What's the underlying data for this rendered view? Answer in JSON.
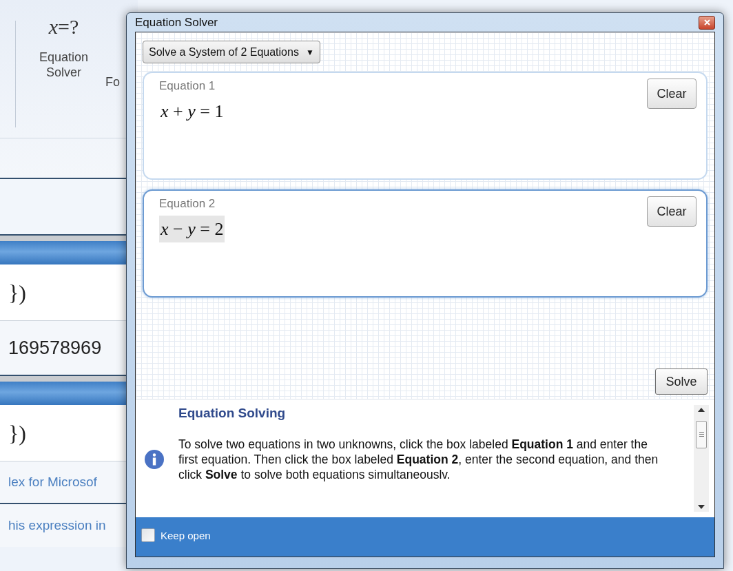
{
  "background_app": {
    "ribbon_button": {
      "icon_label": "*x*=?",
      "label": "Equation Solver"
    },
    "cut_ribbon_label": "Fo",
    "rows": [
      {
        "kind": "result",
        "text": "})"
      },
      {
        "kind": "number",
        "text": "169578969"
      },
      {
        "kind": "result",
        "text": "})"
      },
      {
        "kind": "link",
        "text": "lex for Microsof"
      },
      {
        "kind": "link",
        "text": "his expression in"
      }
    ]
  },
  "window": {
    "title": "Equation Solver",
    "mode_dropdown": {
      "value": "Solve a System of 2 Equations",
      "arrow": "▼"
    },
    "equations": [
      {
        "label": "Equation 1",
        "formula": "*x* + *y* = 1",
        "focused": false,
        "clear_button": "Clear"
      },
      {
        "label": "Equation 2",
        "formula": "*x* − *y* = 2",
        "focused": true,
        "clear_button": "Clear"
      }
    ],
    "solve_button": "Solve",
    "help": {
      "title": "Equation Solving",
      "text": "To solve two equations in two unknowns, click the box labeled **Equation 1** and enter the first equation. Then click the box labeled **Equation 2**, enter the second equation, and then click **Solve**  to solve both equations simultaneouslv."
    },
    "keep_open": {
      "label": "Keep open",
      "checked": false
    }
  }
}
